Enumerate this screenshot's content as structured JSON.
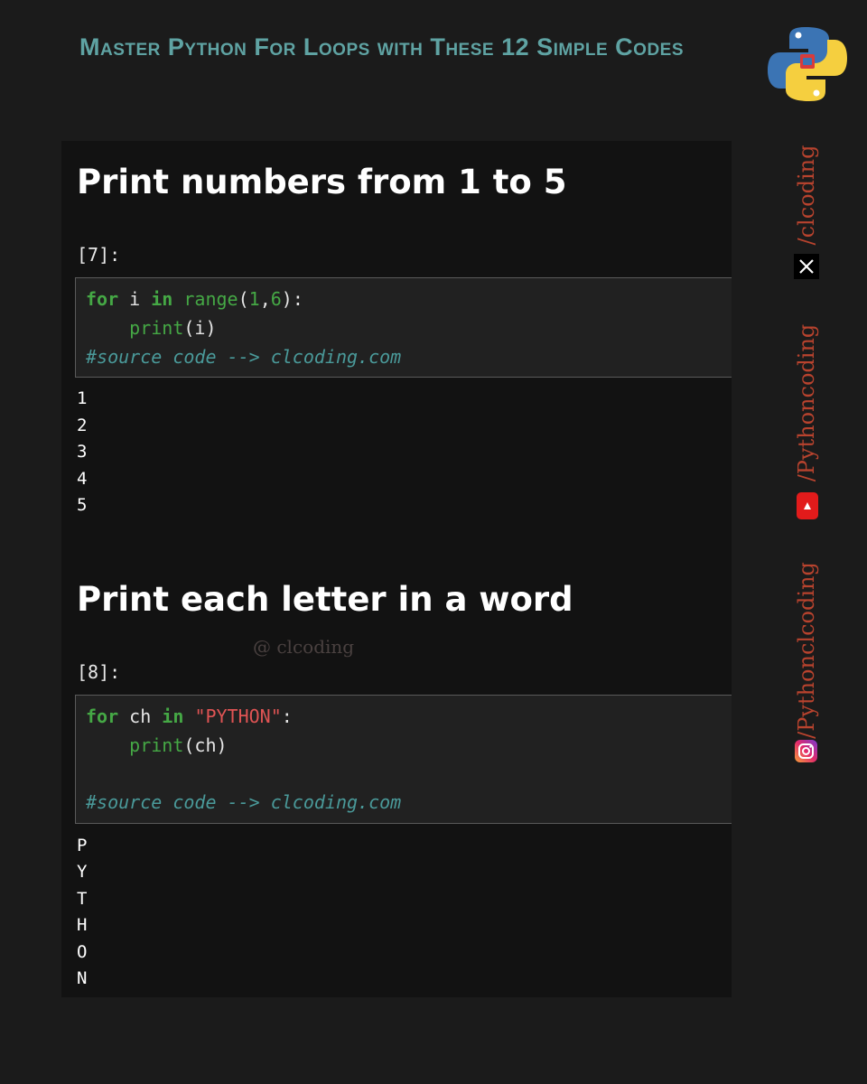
{
  "header": {
    "title": "Master Python For Loops with These 12 Simple Codes",
    "logo_icon": "python-logo-icon"
  },
  "sections": [
    {
      "heading": "Print numbers from 1 to 5",
      "prompt": "[7]:",
      "code": {
        "line1": {
          "kw_for": "for",
          "var": " i ",
          "kw_in": "in",
          "builtin": " range",
          "open": "(",
          "arg1": "1",
          "comma": ",",
          "arg2": "6",
          "close": "):"
        },
        "line2": {
          "indent": "    ",
          "builtin": "print",
          "args": "(i)"
        },
        "comment": "#source code --> clcoding.com"
      },
      "output": [
        "1",
        "2",
        "3",
        "4",
        "5"
      ]
    },
    {
      "heading": "Print each letter in a word",
      "prompt": "[8]:",
      "code": {
        "line1": {
          "kw_for": "for",
          "var": " ch ",
          "kw_in": "in",
          "space": " ",
          "string": "\"PYTHON\"",
          "colon": ":"
        },
        "line2": {
          "indent": "    ",
          "builtin": "print",
          "args": "(ch)"
        },
        "comment": "#source code --> clcoding.com"
      },
      "output": [
        "P",
        "Y",
        "T",
        "H",
        "O",
        "N"
      ]
    }
  ],
  "watermark": "@ clcoding",
  "social": [
    {
      "handle": "/clcoding",
      "icon": "x-icon"
    },
    {
      "handle": "/Pythoncoding",
      "icon": "youtube-icon"
    },
    {
      "handle": "/Pythonclcoding",
      "icon": "instagram-icon"
    }
  ],
  "colors": {
    "background": "#1b1b1b",
    "title": "#5fa3a3",
    "keyword": "#45a845",
    "string": "#e05454",
    "comment": "#4a9a9a",
    "social_handle": "#b8432e"
  }
}
